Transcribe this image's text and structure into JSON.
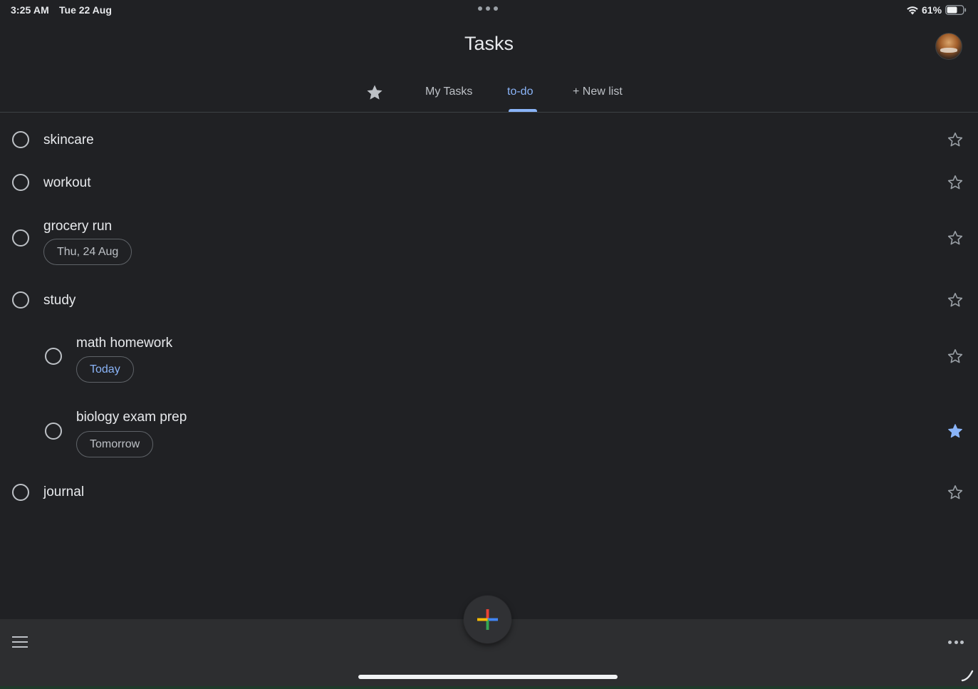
{
  "status_bar": {
    "time": "3:25 AM",
    "date": "Tue 22 Aug",
    "battery": "61%"
  },
  "header": {
    "title": "Tasks"
  },
  "tabs": {
    "starred_icon": "star-icon",
    "my_tasks": "My Tasks",
    "todo": "to-do",
    "new_list": "+ New list",
    "active": "to-do"
  },
  "tasks": [
    {
      "title": "skincare",
      "due": "",
      "starred": false
    },
    {
      "title": "workout",
      "due": "",
      "starred": false
    },
    {
      "title": "grocery run",
      "due": "Thu, 24 Aug",
      "starred": false
    },
    {
      "title": "study",
      "due": "",
      "starred": false
    },
    {
      "title": "math homework",
      "due": "Today",
      "starred": false,
      "subtask": true
    },
    {
      "title": "biology exam prep",
      "due": "Tomorrow",
      "starred": true,
      "subtask": true
    },
    {
      "title": "journal",
      "due": "",
      "starred": false
    }
  ],
  "colors": {
    "background": "#202124",
    "accent": "#8ab4f8",
    "text": "#e8eaed",
    "muted": "#bdc1c6"
  },
  "icons": {
    "fab": "add-plus-icon",
    "menu": "hamburger-menu-icon",
    "more": "more-horizontal-icon"
  }
}
